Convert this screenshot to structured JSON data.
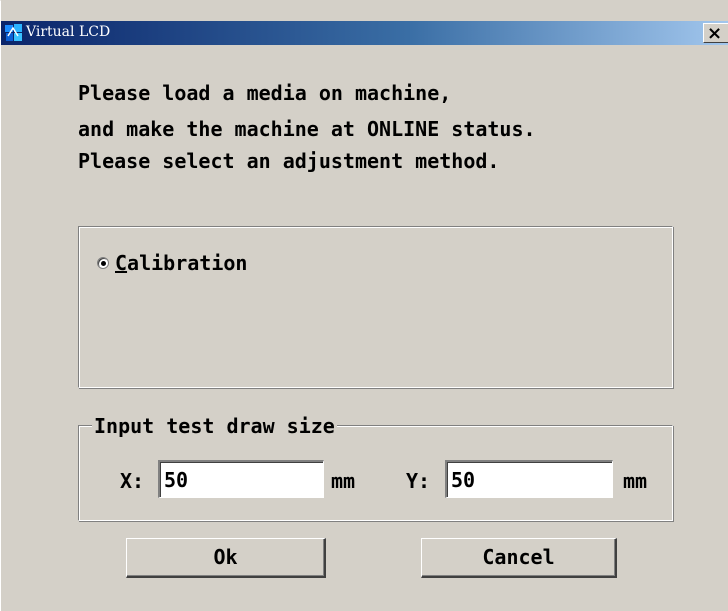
{
  "window": {
    "title": "Virtual LCD",
    "close_glyph": "×",
    "title_bar_color": "#0a246a",
    "icon": "app-icon"
  },
  "message": {
    "line1": "Please load a media on machine,",
    "line2": "and make the machine at ONLINE status.",
    "line3": "Please select an adjustment method."
  },
  "method": {
    "options": [
      {
        "label_underlined": "C",
        "label_rest": "alibration",
        "selected": true
      }
    ]
  },
  "test_size": {
    "legend": "Input test draw size",
    "x_label": "X:",
    "x_value": "50",
    "x_unit": "mm",
    "y_label": "Y:",
    "y_value": "50",
    "y_unit": "mm"
  },
  "buttons": {
    "ok_label": "Ok",
    "cancel_label": "Cancel"
  }
}
